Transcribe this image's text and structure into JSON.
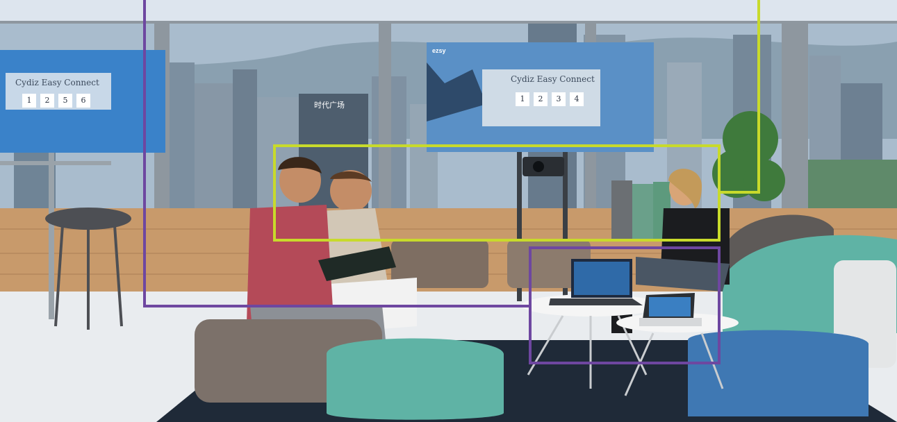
{
  "screens": {
    "left": {
      "title": "Cydiz Easy Connect",
      "digits": [
        "1",
        "2",
        "5",
        "6"
      ]
    },
    "center": {
      "brand": "ezsy",
      "title": "Cydiz Easy Connect",
      "digits": [
        "1",
        "2",
        "3",
        "4"
      ]
    }
  },
  "building_sign": "时代广场",
  "colors": {
    "sky": "#dde5ee",
    "window_tint": "#a9bccd",
    "frame_blue": "#3a82c9",
    "wood": "#c89a6b",
    "teal": "#5fb3a5",
    "blue_pouf": "#3f78b3",
    "box_purple": "#6e47a0",
    "box_yellow_green": "#c8da2b"
  }
}
